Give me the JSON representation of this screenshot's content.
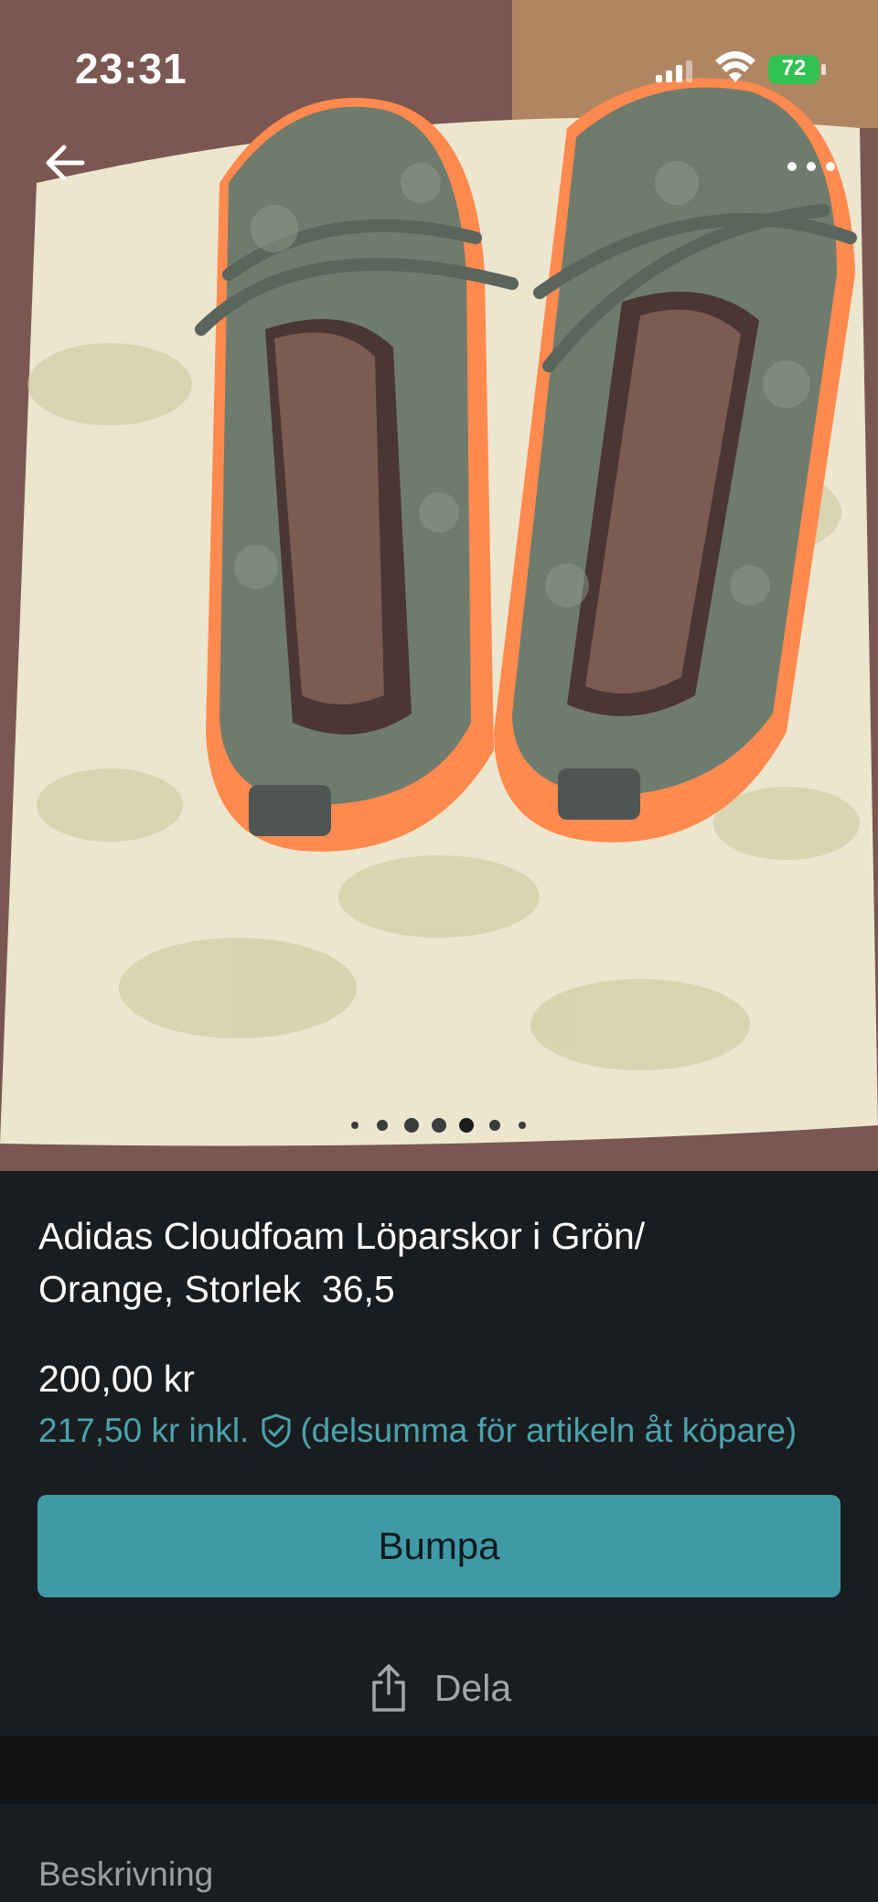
{
  "status_bar": {
    "time": "23:31",
    "battery_level": "72"
  },
  "listing": {
    "title_line1": "Adidas Cloudfoam Löparskor i Grön/",
    "title_line2": "Orange, Storlek  36,5",
    "price": "200,00 kr",
    "price_incl_amount": "217,50 kr inkl.",
    "price_incl_note": "(delsumma för artikeln åt köpare)"
  },
  "photo": {
    "total_images": 7,
    "current_image": 5,
    "alt": "Shoes on a pillow"
  },
  "actions": {
    "bump_label": "Bumpa",
    "share_label": "Dela"
  },
  "description": {
    "heading": "Beskrivning"
  },
  "icons": {
    "back": "arrow-left-icon",
    "more": "more-horizontal-icon",
    "shield": "shield-check-icon",
    "share": "share-icon"
  },
  "colors": {
    "background": "#1a1d20",
    "accent": "#3f9aa6",
    "accent_text": "#4aa3ad",
    "secondary_text": "#a2a6aa",
    "battery": "#31c150"
  }
}
